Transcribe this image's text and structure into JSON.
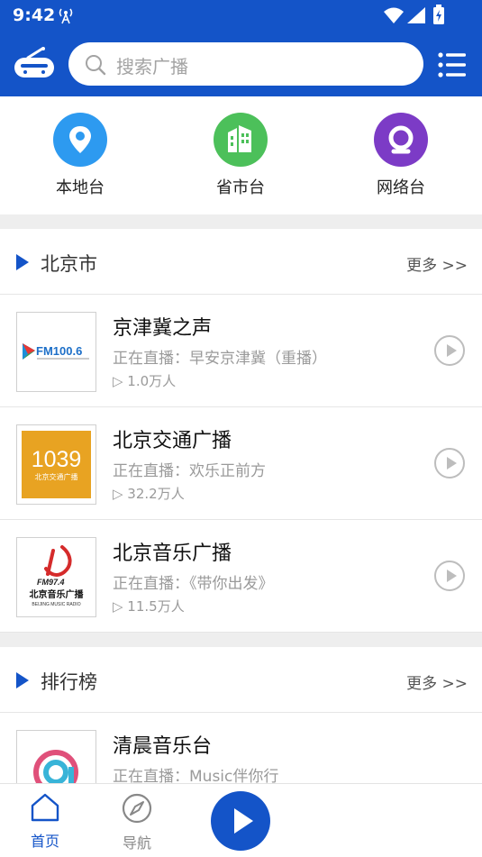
{
  "status": {
    "time": "9:42"
  },
  "search": {
    "placeholder": "搜索广播"
  },
  "categories": [
    {
      "label": "本地台",
      "icon": "location-pin-icon",
      "color": "#2d9af0"
    },
    {
      "label": "省市台",
      "icon": "building-icon",
      "color": "#4cc05a"
    },
    {
      "label": "网络台",
      "icon": "network-q-icon",
      "color": "#7c3bc6"
    }
  ],
  "sections": [
    {
      "title": "北京市",
      "more": "更多 >>",
      "items": [
        {
          "name": "京津冀之声",
          "live": "正在直播：早安京津冀（重播）",
          "count": "▷ 1.0万人",
          "logo_text": "FM100.6"
        },
        {
          "name": "北京交通广播",
          "live": "正在直播：欢乐正前方",
          "count": "▷ 32.2万人",
          "logo_text": "1039",
          "logo_sub": "北京交通广播"
        },
        {
          "name": "北京音乐广播",
          "live": "正在直播：《带你出发》",
          "count": "▷ 11.5万人",
          "logo_text": "FM97.4",
          "logo_sub": "北京音乐广播",
          "logo_en": "BEIJING MUSIC RADIO"
        }
      ]
    },
    {
      "title": "排行榜",
      "more": "更多 >>",
      "items": [
        {
          "name": "清晨音乐台",
          "live": "正在直播：Music伴你行",
          "count": ""
        }
      ]
    }
  ],
  "bottom_nav": {
    "home": "首页",
    "nav": "导航"
  },
  "colors": {
    "primary": "#1454c8",
    "background": "#eeeeee"
  }
}
